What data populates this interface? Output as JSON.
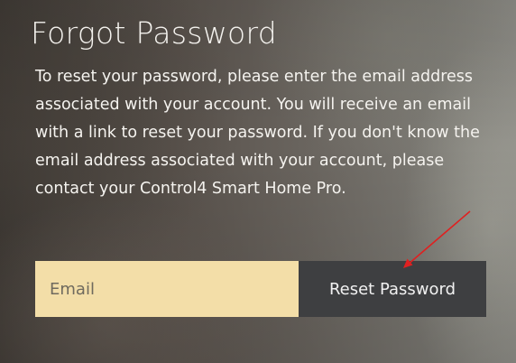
{
  "page": {
    "title": "Forgot Password",
    "description": "To reset your password, please enter the email address associated with your account. You will receive an email with a link to reset your password. If you don't know the email address associated with your account, please contact your Control4 Smart Home Pro."
  },
  "form": {
    "email": {
      "placeholder": "Email",
      "value": ""
    },
    "reset_label": "Reset Password"
  },
  "colors": {
    "input_background": "#f3dea8",
    "button_background": "#3e3f41",
    "annotation_arrow": "#e02020",
    "text": "#f4f2ee"
  },
  "icons": {
    "annotation": "red-arrow-icon"
  }
}
